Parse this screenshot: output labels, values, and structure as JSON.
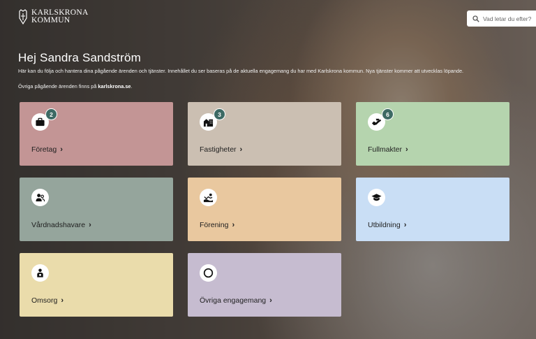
{
  "header": {
    "logo_line1": "KARLSKRONA",
    "logo_line2": "KOMMUN",
    "search_placeholder": "Vad letar du efter?"
  },
  "intro": {
    "greeting": "Hej Sandra Sandström",
    "description": "Här kan du följa och hantera dina pågående ärenden och tjänster. Innehållet du ser baseras på de aktuella engagemang du har med Karlskrona kommun. Nya tjänster kommer att utvecklas löpande.",
    "other_prefix": "Övriga pågående ärenden finns på",
    "other_link": "karlskrona.se",
    "other_suffix": "."
  },
  "cards": [
    {
      "label": "Företag",
      "badge": "2",
      "icon": "briefcase-icon",
      "color": "#c39595"
    },
    {
      "label": "Fastigheter",
      "badge": "3",
      "icon": "buildings-icon",
      "color": "#cbbfb2"
    },
    {
      "label": "Fullmakter",
      "badge": "6",
      "icon": "handshake-icon",
      "color": "#b5d4ae"
    },
    {
      "label": "Vårdnadshavare",
      "badge": "",
      "icon": "family-icon",
      "color": "#95a59c"
    },
    {
      "label": "Förening",
      "badge": "",
      "icon": "association-icon",
      "color": "#e9c89f"
    },
    {
      "label": "Utbildning",
      "badge": "",
      "icon": "graduation-cap-icon",
      "color": "#c9def5"
    },
    {
      "label": "Omsorg",
      "badge": "",
      "icon": "care-icon",
      "color": "#eadcab"
    },
    {
      "label": "Övriga engagemang",
      "badge": "",
      "icon": "circle-icon",
      "color": "#c6bcd0"
    }
  ]
}
